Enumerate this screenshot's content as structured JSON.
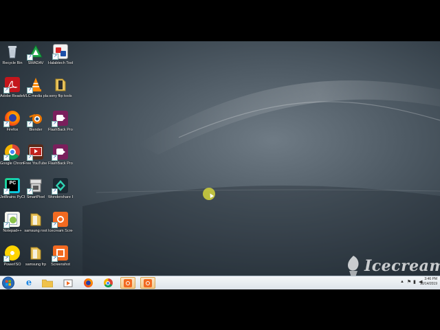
{
  "desktop": {
    "icons": [
      {
        "label": "Recycle Bin",
        "icon": "recycle-bin-icon"
      },
      {
        "label": "SMADAV",
        "icon": "smadav-icon"
      },
      {
        "label": "Halabtech Tool_v0.7",
        "icon": "halabtech-icon"
      },
      {
        "label": "Adobe Reader 9",
        "icon": "adobe-reader-icon"
      },
      {
        "label": "VLC media player",
        "icon": "vlc-icon"
      },
      {
        "label": "sony flip tools",
        "icon": "sony-flip-tools-icon"
      },
      {
        "label": "Firefox",
        "icon": "firefox-icon"
      },
      {
        "label": "Blender",
        "icon": "blender-icon"
      },
      {
        "label": "FlashBack Pro 5 Player",
        "icon": "flashback-player-icon"
      },
      {
        "label": "Google Chrome",
        "icon": "chrome-icon"
      },
      {
        "label": "Free YouTube ...",
        "icon": "free-youtube-icon"
      },
      {
        "label": "FlashBack Pro 5 Re...",
        "icon": "flashback-recorder-icon"
      },
      {
        "label": "JetBrains PyCharm ...",
        "icon": "pycharm-icon"
      },
      {
        "label": "SmartPixel",
        "icon": "smartpixel-icon"
      },
      {
        "label": "Wondershare Filmora Scrn",
        "icon": "filmora-icon"
      },
      {
        "label": "Notepad++",
        "icon": "notepadpp-icon"
      },
      {
        "label": "samsung root",
        "icon": "samsung-root-folder-icon"
      },
      {
        "label": "Icecream Screen ...",
        "icon": "icecream-screen-icon"
      },
      {
        "label": "PowerISO",
        "icon": "poweriso-icon"
      },
      {
        "label": "samsung frp",
        "icon": "samsung-frp-folder-icon"
      },
      {
        "label": "Screenshot",
        "icon": "screenshot-icon"
      }
    ]
  },
  "watermark": {
    "text": "Icecream"
  },
  "taskbar": {
    "items": [
      "windows-start-icon",
      "internet-explorer-icon",
      "file-explorer-icon",
      "media-player-icon",
      "firefox-icon",
      "chrome-icon",
      "icecream-recorder-icon",
      "icecream-recorder-icon"
    ],
    "clock": {
      "time": "3:46 PM",
      "date": "10/14/2019"
    }
  },
  "colors": {
    "cursor_highlight": "#d4d43c",
    "taskbar_bg": "#e6ecf1",
    "active_item": "#f2c98c"
  }
}
